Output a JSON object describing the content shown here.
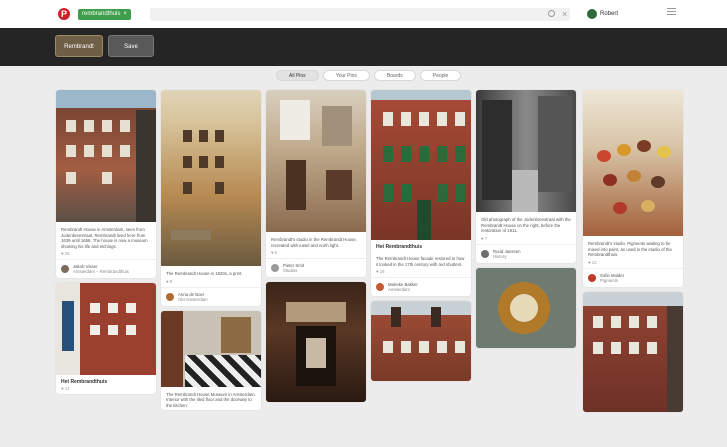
{
  "header": {
    "logo_letter": "P",
    "search_tag": "rembrandthuis",
    "search_tag_remove": "×",
    "close_glyph": "×",
    "user_name": "Robert"
  },
  "boards": {
    "active_label": "Rembrandt",
    "other_label": "Save"
  },
  "tabs": [
    {
      "label": "All Pins"
    },
    {
      "label": "Your Pins"
    },
    {
      "label": "Boards"
    },
    {
      "label": "People"
    }
  ],
  "pins": [
    {
      "col": 0,
      "desc": "Rembrandt House in Amsterdam, seen from Jodenbreestraat. Rembrandt lived here from 1639 until 1658. The house is now a museum showing his life and etchings.",
      "meta": "♥ 26",
      "pinner_name": "Jakob Visser",
      "pinner_board": "Amsterdam – Rembrandthuis"
    },
    {
      "col": 0,
      "title": "Het Rembrandthuis",
      "desc": "♥ 14"
    },
    {
      "col": 1,
      "desc": "The Rembrandt House in 1920s, a print.",
      "meta": "♥ 9",
      "pinner_name": "Anna de Boer",
      "pinner_board": "Old Amsterdam"
    },
    {
      "col": 1,
      "desc": "The Rembrandt House Museum in Amsterdam. Interior with the tiled floor and the doorway to the kitchen.",
      "meta": "♥ 11"
    },
    {
      "col": 2,
      "desc": "Rembrandt's studio in the Rembrandt House, recreated with easel and north light.",
      "meta": "♥ 5",
      "pinner_name": "Pieter Smit",
      "pinner_board": "Studios"
    },
    {
      "col": 3,
      "title": "Het Rembrandthuis",
      "desc": "The Rembrandt House facade restored to how it looked in the 17th century with red shutters.",
      "meta": "♥ 18",
      "pinner_name": "Marieke Bakker",
      "pinner_board": "Amsterdam"
    },
    {
      "col": 4,
      "desc": "Old photograph of the Jodenbreestraat with the Rembrandt House on the right, before the restoration of 1911.",
      "meta": "♥ 7",
      "pinner_name": "Ruud Janssen",
      "pinner_board": "History"
    },
    {
      "col": 5,
      "desc": "Rembrandt's studio. Pigments waiting to be mixed into paint, as used in the studio of the Rembrandthuis.",
      "meta": "♥ 12",
      "pinner_name": "Sofie Mulder",
      "pinner_board": "Pigments"
    }
  ]
}
